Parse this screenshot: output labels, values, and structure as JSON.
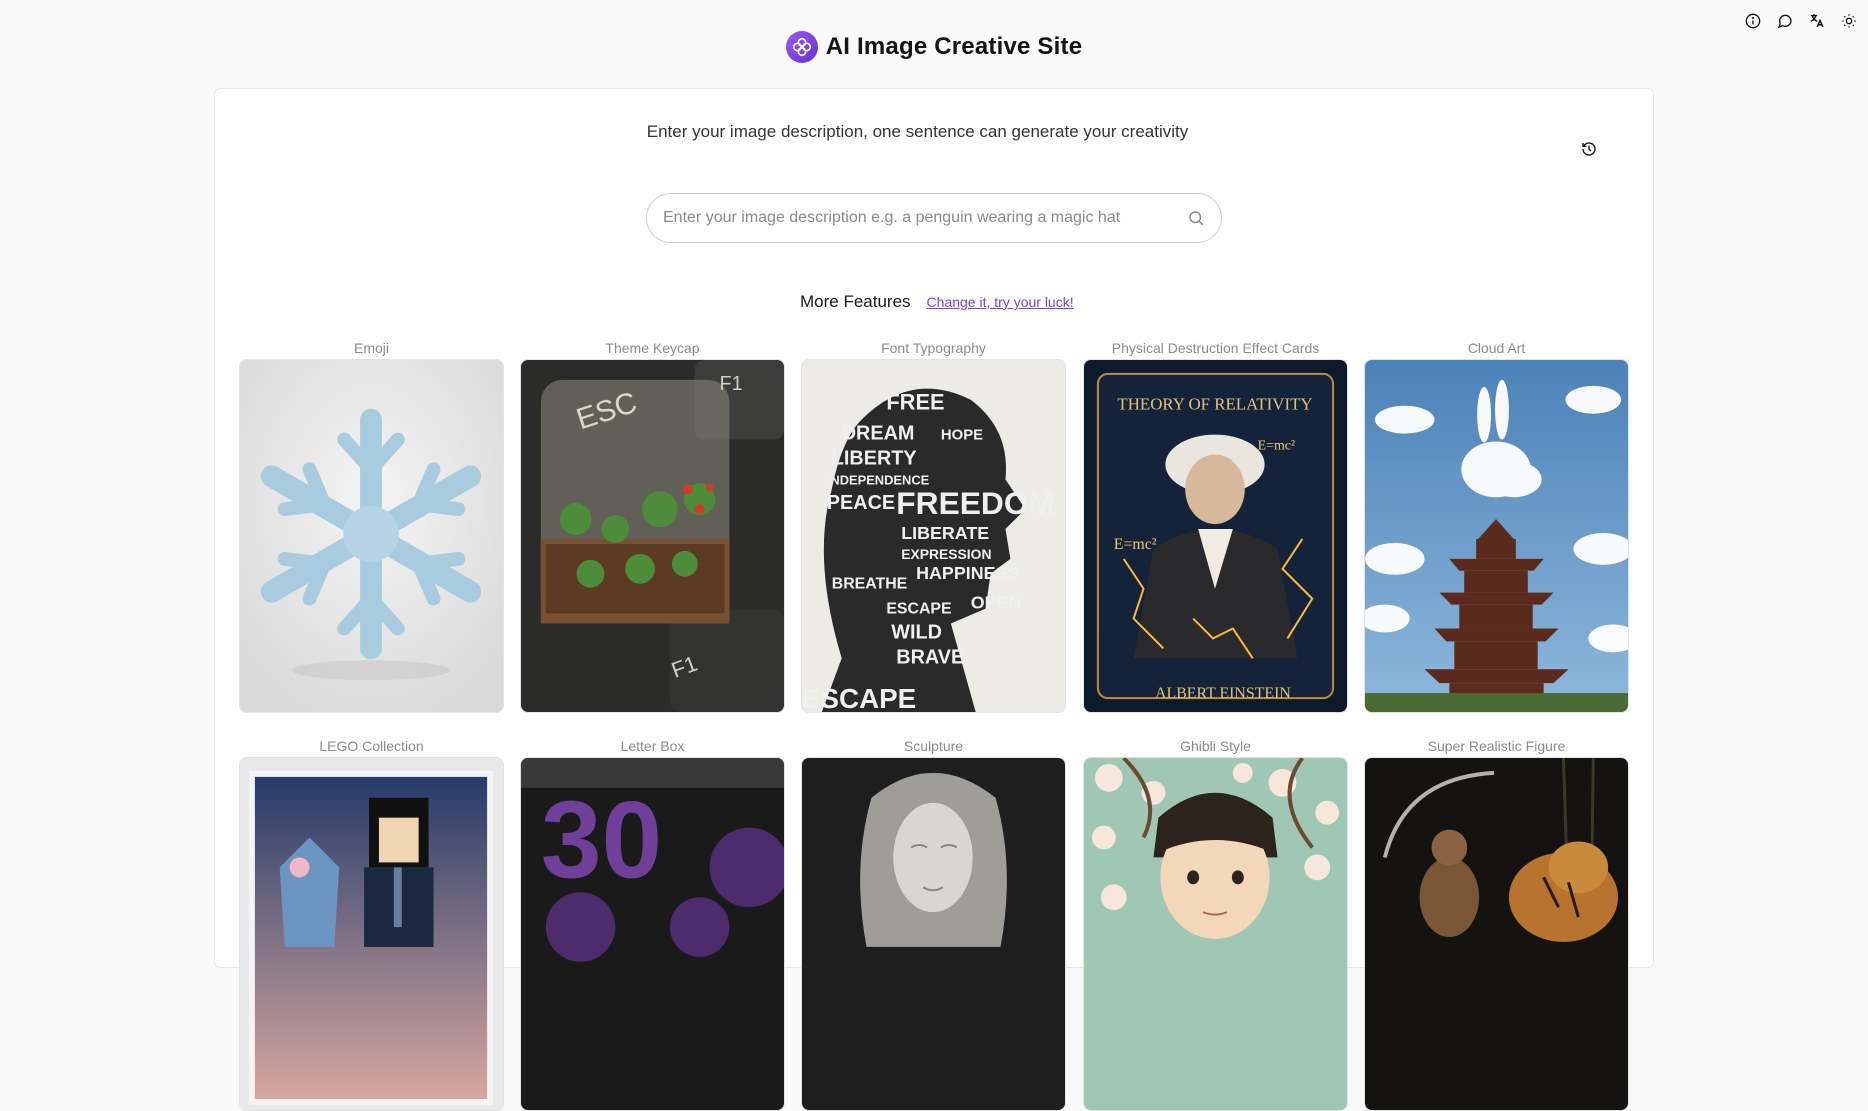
{
  "header": {
    "title": "AI Image Creative Site",
    "icons": [
      "info-icon",
      "chat-icon",
      "translate-icon",
      "theme-sun-icon"
    ]
  },
  "main": {
    "subtitle": "Enter your image description, one sentence can generate your creativity",
    "search": {
      "value": "",
      "placeholder": "Enter your image description e.g. a penguin wearing a magic hat"
    },
    "features": {
      "title": "More Features",
      "luck_link": "Change it, try your luck!"
    },
    "cards": [
      {
        "label": "Emoji"
      },
      {
        "label": "Theme Keycap",
        "keycap_top": "ESC",
        "keycap_bottom": "F1",
        "keycap_corner": "F1"
      },
      {
        "label": "Font Typography",
        "words": [
          "FREE",
          "DREAM",
          "HOPE",
          "LIBERTY",
          "INDEPENDENCE",
          "PEACE",
          "FREEDOM",
          "LIBERATE",
          "EXPRESSION",
          "HAPPINESS",
          "BREATHE",
          "ESCAPE",
          "WILD",
          "BRAVE",
          "OPEN"
        ]
      },
      {
        "label": "Physical Destruction Effect Cards",
        "card_title": "THEORY OF RELATIVITY",
        "card_name": "ALBERT EINSTEIN",
        "formula": "E=mc²"
      },
      {
        "label": "Cloud Art"
      },
      {
        "label": "LEGO Collection"
      },
      {
        "label": "Letter Box",
        "number": "30"
      },
      {
        "label": "Sculpture"
      },
      {
        "label": "Ghibli Style"
      },
      {
        "label": "Super Realistic Figure"
      }
    ]
  },
  "colors": {
    "accent": "#7b3fe4",
    "page_bg": "#f9f9f9",
    "panel_bg": "#ffffff"
  }
}
